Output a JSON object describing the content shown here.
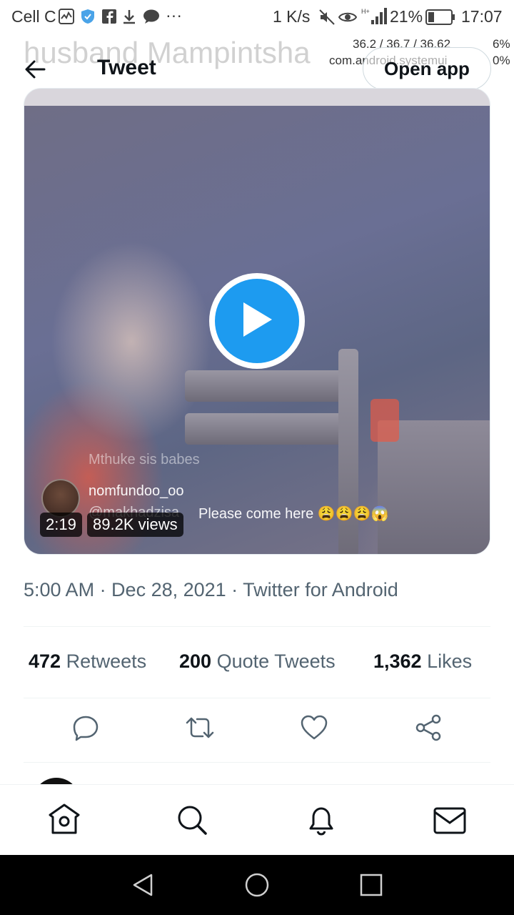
{
  "status_bar": {
    "carrier": "Cell C",
    "network_speed": "1 K/s",
    "battery_percent": "21%",
    "time": "17:07",
    "ellipsis": "···"
  },
  "overlays": {
    "ghost_text": "husband Mampintsha",
    "stats_line": "36.2 / 36.7 / 36.62",
    "stats_pct_1": "6%",
    "stats_pct_2": "0%",
    "process_name": "com.android.systemui"
  },
  "header": {
    "title": "Tweet",
    "open_app_label": "Open app"
  },
  "media": {
    "duration": "2:19",
    "views": "89.2K views",
    "comment_faded": "Mthuke sis babes",
    "comment_user": "nomfundoo_oo",
    "comment_handle": "@makhadzisa",
    "comment_text": "Please come here 😩😩😩😱"
  },
  "tweet": {
    "timestamp": "5:00 AM · Dec 28, 2021 · Twitter for Android",
    "retweets_count": "472",
    "retweets_label": "Retweets",
    "quotes_count": "200",
    "quotes_label": "Quote Tweets",
    "likes_count": "1,362",
    "likes_label": "Likes"
  },
  "icons": {
    "back": "back-arrow-icon",
    "reply": "reply-icon",
    "retweet": "retweet-icon",
    "like": "heart-icon",
    "share": "share-icon",
    "home": "home-icon",
    "search": "search-icon",
    "notifications": "bell-icon",
    "messages": "mail-icon"
  },
  "colors": {
    "accent": "#1d9bf0",
    "text_primary": "#0f1419",
    "text_secondary": "#536471"
  }
}
